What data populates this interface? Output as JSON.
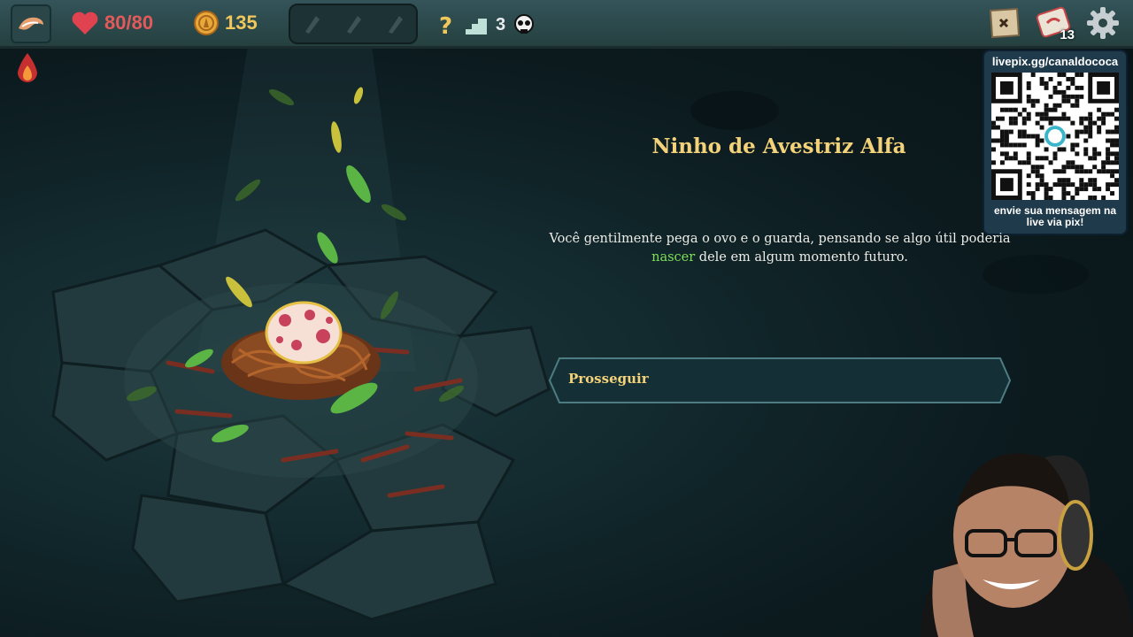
{
  "hud": {
    "hp": "80/80",
    "gold": "135",
    "floor": "3",
    "deck_count": "13",
    "hp_color": "#e45a5a",
    "gold_color": "#f0c75a"
  },
  "overlay": {
    "url": "livepix.gg/canaldococa",
    "message": "envie sua mensagem na live via pix!"
  },
  "event": {
    "title": "Ninho de Avestriz Alfa",
    "body_before": "Você gentilmente pega o ovo e o guarda, pensando se algo útil poderia",
    "body_highlight": "nascer",
    "body_after": "dele em algum momento futuro.",
    "highlight_color": "#7fe05a",
    "choice": "Prosseguir"
  }
}
